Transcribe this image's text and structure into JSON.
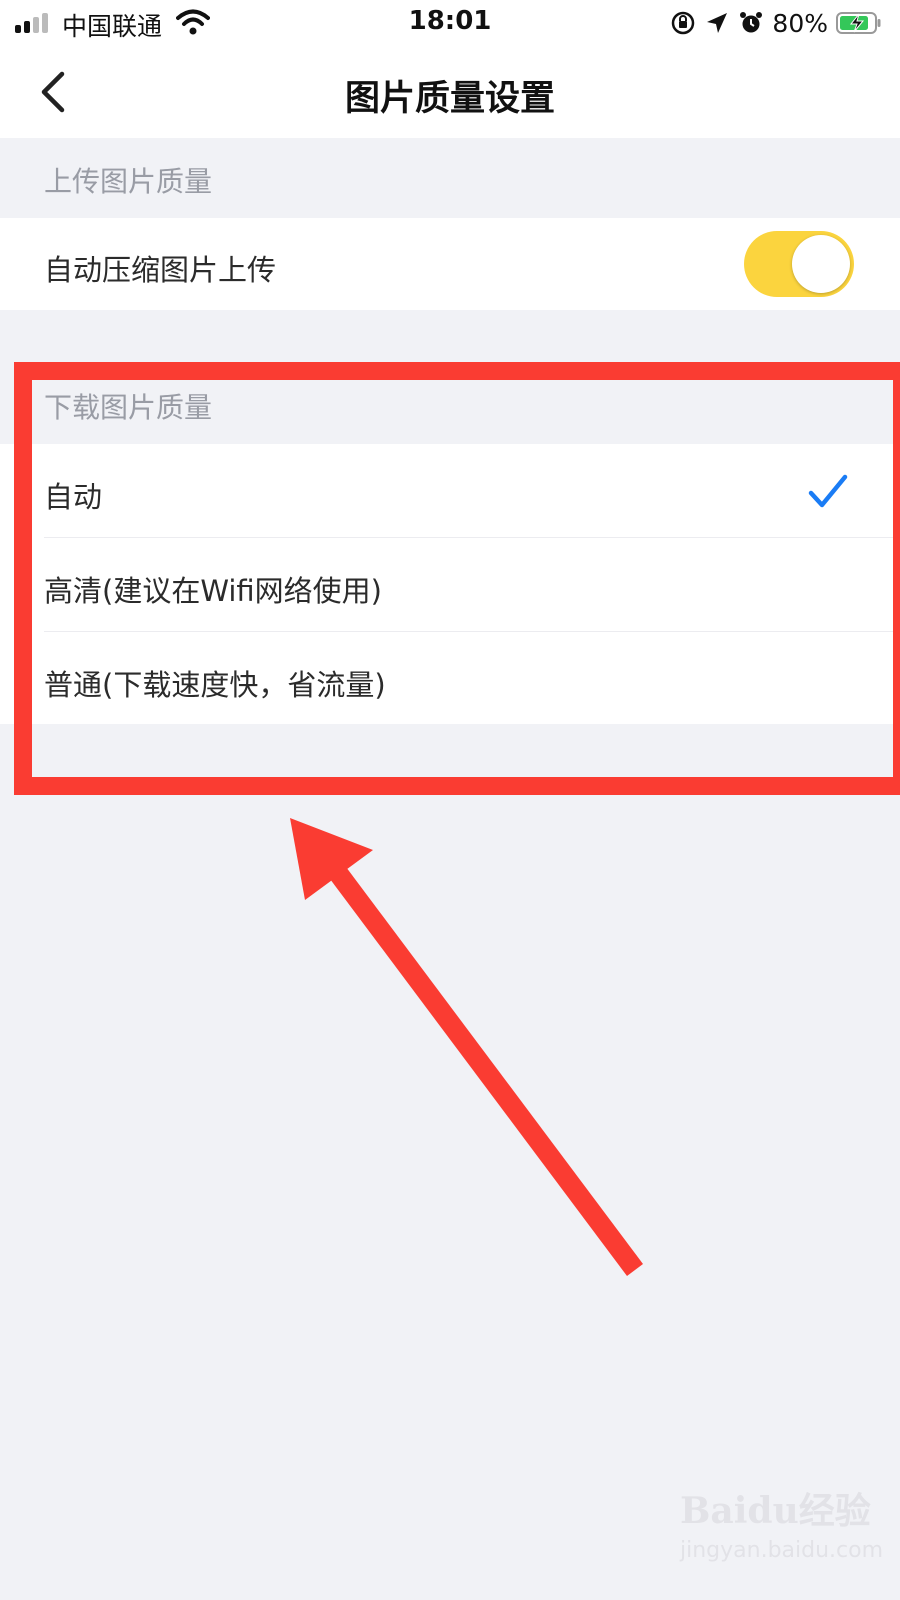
{
  "status_bar": {
    "carrier": "中国联通",
    "time": "18:01",
    "battery_percent": "80%"
  },
  "nav": {
    "title": "图片质量设置"
  },
  "upload_section": {
    "header": "上传图片质量",
    "auto_compress_label": "自动压缩图片上传",
    "auto_compress_enabled": true
  },
  "download_section": {
    "header": "下载图片质量",
    "options": [
      {
        "label": "自动",
        "selected": true
      },
      {
        "label": "高清(建议在Wifi网络使用)",
        "selected": false
      },
      {
        "label": "普通(下载速度快，省流量)",
        "selected": false
      }
    ]
  },
  "colors": {
    "accent_toggle": "#fbd43e",
    "check": "#1a7cf5",
    "annotation": "#fa3c32"
  },
  "watermark": {
    "brand": "Baidu经验",
    "url": "jingyan.baidu.com"
  }
}
